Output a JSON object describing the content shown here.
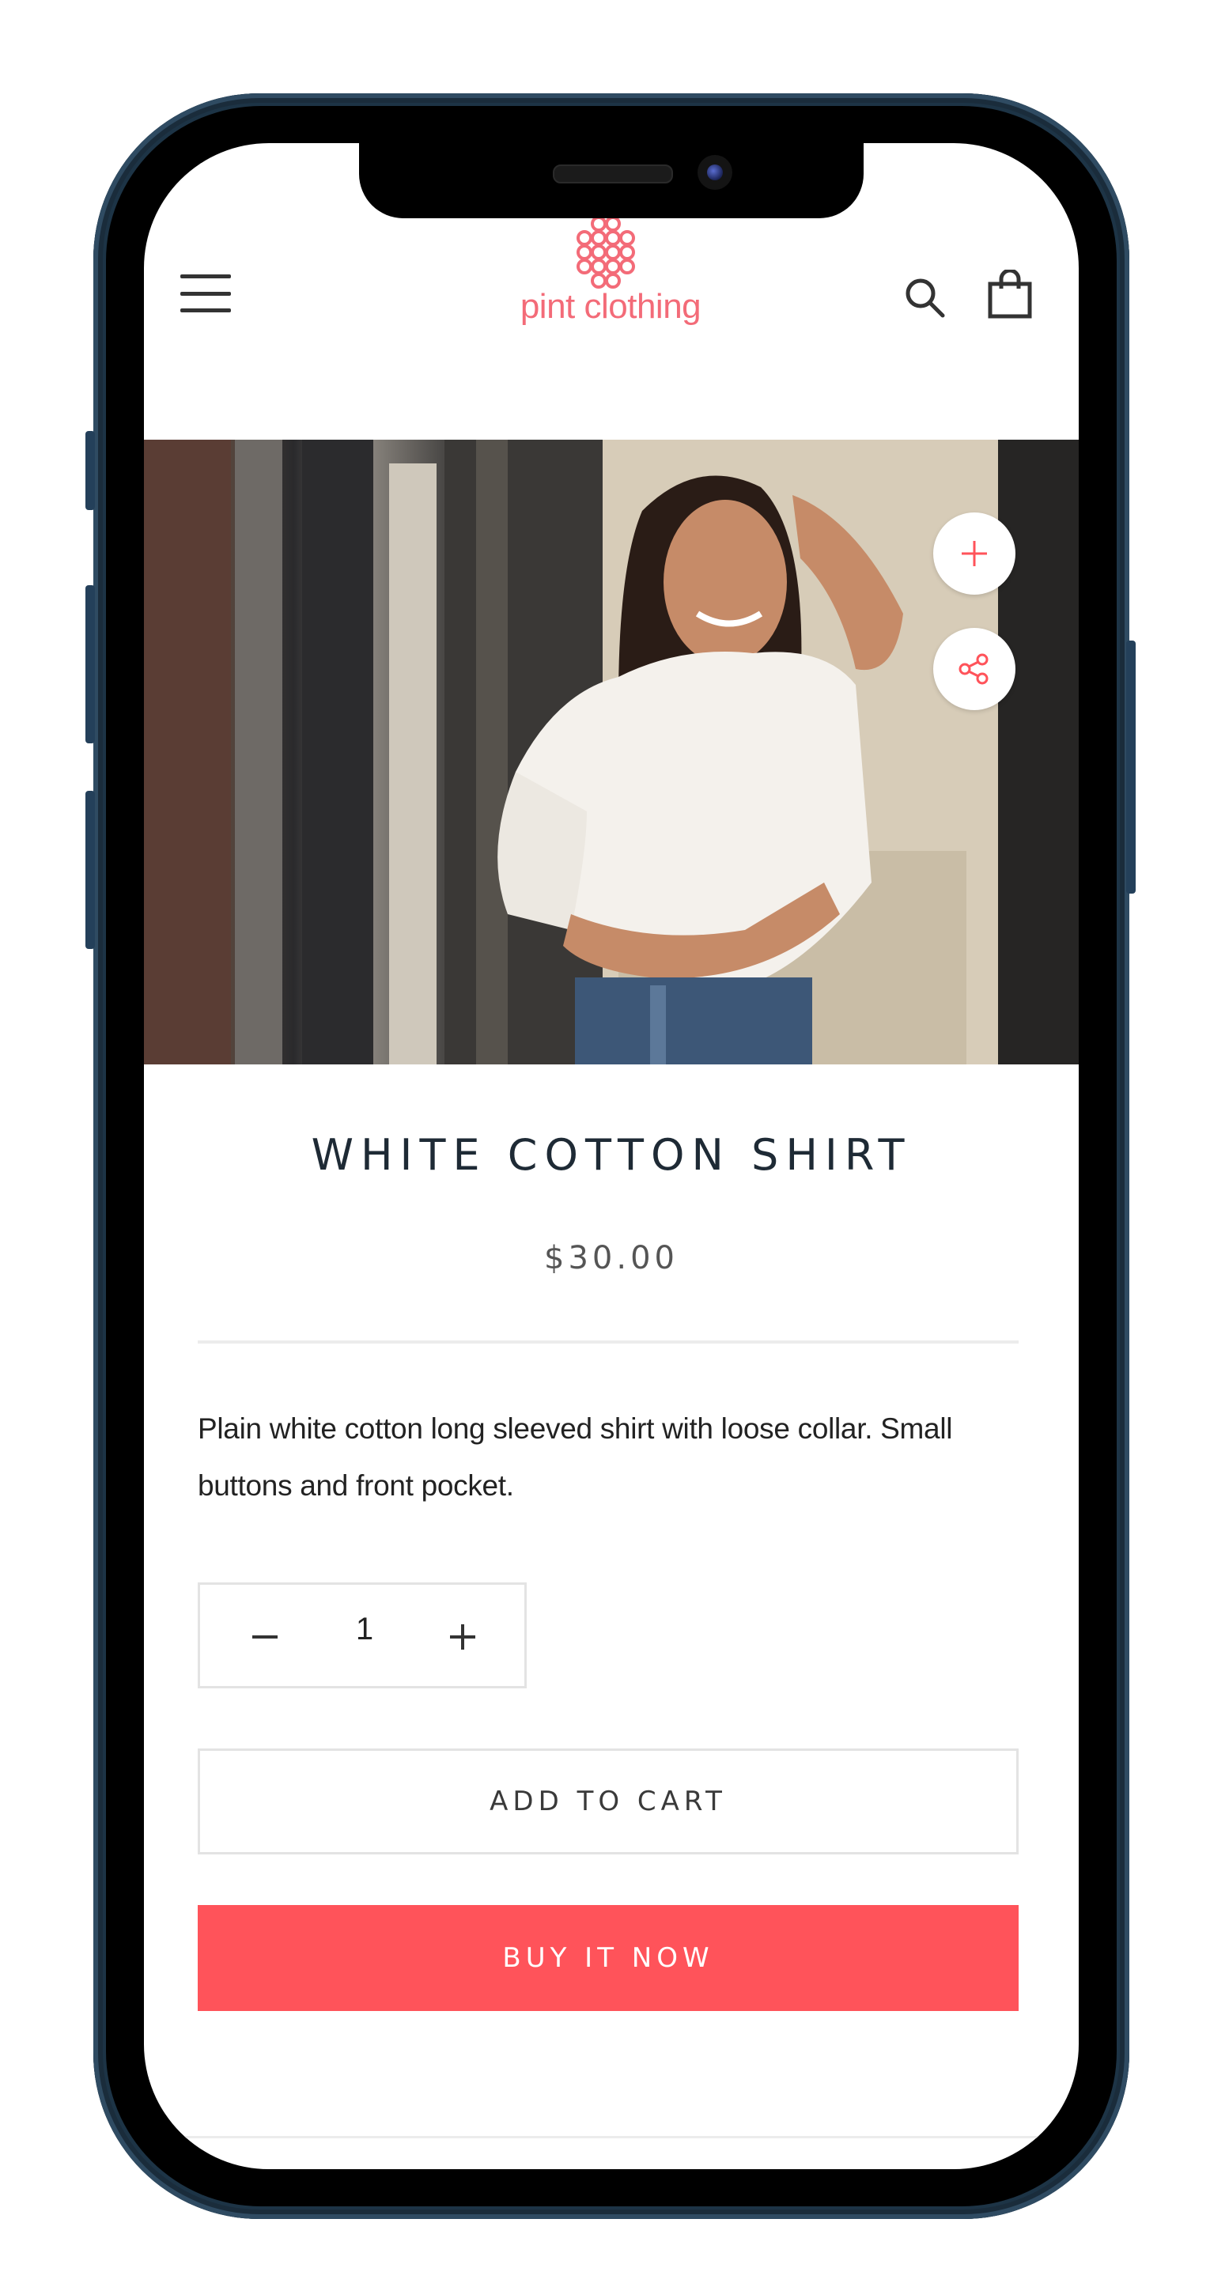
{
  "store": {
    "name": "pint clothing",
    "brand_color": "#f36b78"
  },
  "header": {
    "menu_icon": "hamburger-menu-icon",
    "search_icon": "search-icon",
    "cart_icon": "shopping-bag-icon"
  },
  "product": {
    "title": "WHITE COTTON SHIRT",
    "price": "$30.00",
    "description": "Plain white cotton long sleeved shirt with loose collar. Small buttons and front pocket.",
    "image_actions": {
      "zoom_icon": "plus-icon",
      "share_icon": "share-icon"
    }
  },
  "quantity": {
    "value": "1",
    "decrease_icon": "minus-icon",
    "increase_icon": "plus-icon"
  },
  "actions": {
    "add_to_cart_label": "ADD TO CART",
    "buy_now_label": "BUY IT NOW"
  },
  "colors": {
    "accent": "#ff535a",
    "text_dark": "#1e2a35",
    "border": "#e3e3e3"
  }
}
